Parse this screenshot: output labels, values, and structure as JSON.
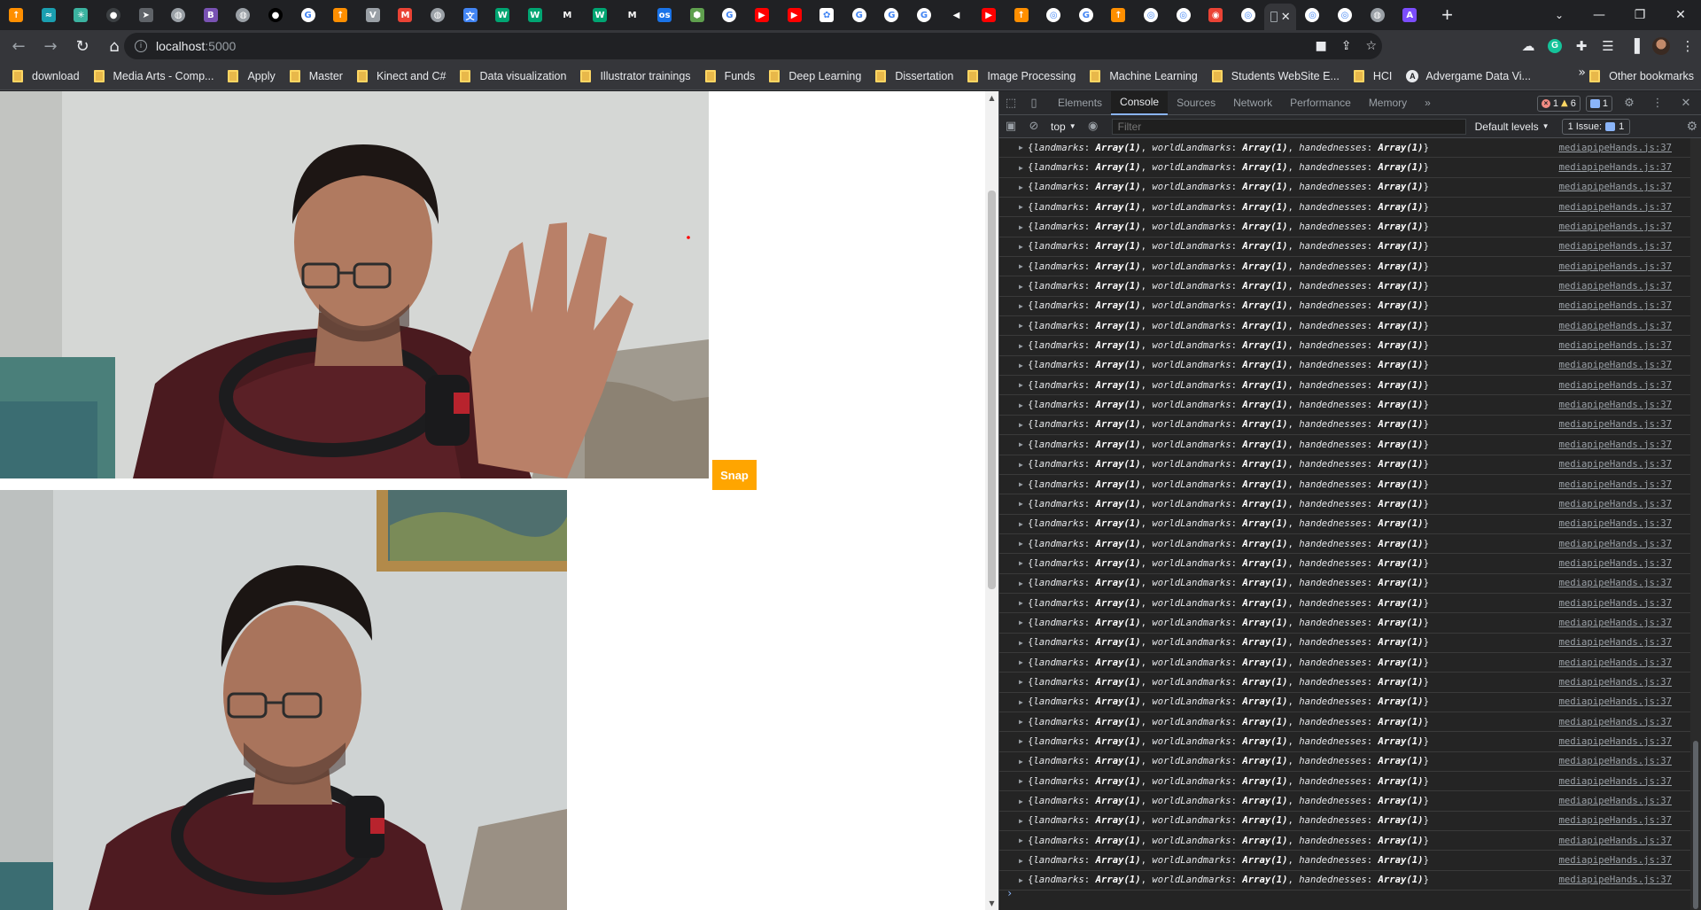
{
  "browser": {
    "tabs": [
      {
        "icon": "pinkleaf-icon",
        "color": "#ff8f00",
        "glyph": "↑"
      },
      {
        "icon": "dragon-icon",
        "color": "#1a9fb0",
        "glyph": "≈"
      },
      {
        "icon": "atom-icon",
        "color": "#3bb3a0",
        "glyph": "✳"
      },
      {
        "icon": "circle-icon",
        "color": "#3c4043",
        "glyph": "●"
      },
      {
        "icon": "plane-icon",
        "color": "#5f6368",
        "glyph": "➤"
      },
      {
        "icon": "globe-icon",
        "color": "#9aa0a6",
        "glyph": "◍"
      },
      {
        "icon": "bootstrap-icon",
        "color": "#7952b3",
        "glyph": "B"
      },
      {
        "icon": "globe-icon",
        "color": "#9aa0a6",
        "glyph": "◍"
      },
      {
        "icon": "dark-circle-icon",
        "color": "#000000",
        "glyph": "●"
      },
      {
        "icon": "google-icon",
        "color": "#ffffff",
        "glyph": "G"
      },
      {
        "icon": "pinkleaf-icon",
        "color": "#ff8f00",
        "glyph": "↑"
      },
      {
        "icon": "v-icon",
        "color": "#9aa0a6",
        "glyph": "V"
      },
      {
        "icon": "gmail-icon",
        "color": "#ea4335",
        "glyph": "M"
      },
      {
        "icon": "globe-icon",
        "color": "#9aa0a6",
        "glyph": "◍"
      },
      {
        "icon": "translate-icon",
        "color": "#4285f4",
        "glyph": "文"
      },
      {
        "icon": "w-icon",
        "color": "#00a572",
        "glyph": "W"
      },
      {
        "icon": "w-icon",
        "color": "#00a572",
        "glyph": "W"
      },
      {
        "icon": "medium-icon",
        "color": "#202124",
        "glyph": "M"
      },
      {
        "icon": "w-icon",
        "color": "#00a572",
        "glyph": "W"
      },
      {
        "icon": "medium-icon",
        "color": "#202124",
        "glyph": "M"
      },
      {
        "icon": "os-icon",
        "color": "#1a73e8",
        "glyph": "os"
      },
      {
        "icon": "node-icon",
        "color": "#5fa04e",
        "glyph": "⬢"
      },
      {
        "icon": "google-icon",
        "color": "#ffffff",
        "glyph": "G"
      },
      {
        "icon": "youtube-icon",
        "color": "#ff0000",
        "glyph": "▶"
      },
      {
        "icon": "youtube-icon",
        "color": "#ff0000",
        "glyph": "▶"
      },
      {
        "icon": "openai-icon",
        "color": "#ffffff",
        "glyph": "✿"
      },
      {
        "icon": "google-icon",
        "color": "#ffffff",
        "glyph": "G"
      },
      {
        "icon": "google-icon",
        "color": "#ffffff",
        "glyph": "G"
      },
      {
        "icon": "google-icon",
        "color": "#ffffff",
        "glyph": "G"
      },
      {
        "icon": "audio-icon",
        "color": "#202124",
        "glyph": "◀"
      },
      {
        "icon": "youtube-icon",
        "color": "#ff0000",
        "glyph": "▶"
      },
      {
        "icon": "pinkleaf-icon",
        "color": "#ff8f00",
        "glyph": "↑"
      },
      {
        "icon": "github-icon",
        "color": "#ffffff",
        "glyph": "◎"
      },
      {
        "icon": "google-icon",
        "color": "#ffffff",
        "glyph": "G"
      },
      {
        "icon": "pinkleaf-icon",
        "color": "#ff8f00",
        "glyph": "↑"
      },
      {
        "icon": "github-icon",
        "color": "#ffffff",
        "glyph": "◎"
      },
      {
        "icon": "github-icon",
        "color": "#ffffff",
        "glyph": "◎"
      },
      {
        "icon": "record-icon",
        "color": "#ea4335",
        "glyph": "◉"
      },
      {
        "icon": "github-icon",
        "color": "#ffffff",
        "glyph": "◎"
      }
    ],
    "active_tab": {
      "icon": "blank-icon",
      "close": "✕"
    },
    "tabs_after": [
      {
        "icon": "github-icon",
        "color": "#ffffff",
        "glyph": "◎"
      },
      {
        "icon": "github-icon",
        "color": "#ffffff",
        "glyph": "◎"
      },
      {
        "icon": "globe-icon",
        "color": "#9aa0a6",
        "glyph": "◍"
      },
      {
        "icon": "ai-icon",
        "color": "#7c4dff",
        "glyph": "A"
      }
    ],
    "new_tab": "+",
    "url_host": "localhost",
    "url_port": ":5000",
    "bookmarks": [
      "download",
      "Media Arts - Comp...",
      "Apply",
      "Master",
      "Kinect and C#",
      "Data visualization",
      "Illustrator trainings",
      "Funds",
      "Deep Learning",
      "Dissertation",
      "Image Processing",
      "Machine Learning",
      "Students WebSite E...",
      "HCI"
    ],
    "bookmark_special": "Advergame Data Vi...",
    "bookmark_overflow": "»",
    "other_bookmarks": "Other bookmarks"
  },
  "page": {
    "snap_label": "Snap"
  },
  "devtools": {
    "tabs": [
      "Elements",
      "Console",
      "Sources",
      "Network",
      "Performance",
      "Memory"
    ],
    "active_tab": "Console",
    "more": "»",
    "errors": "1",
    "warnings": "6",
    "messages": "1",
    "context": "top",
    "filter_placeholder": "Filter",
    "levels": "Default levels",
    "issues_label": "1 Issue:",
    "issues_count": "1",
    "log_source": "mediapipeHands.js:37",
    "log_keys": [
      "landmarks",
      "worldLandmarks",
      "handednesses"
    ],
    "log_value": "Array(1)",
    "log_count": 38,
    "prompt": "›"
  }
}
